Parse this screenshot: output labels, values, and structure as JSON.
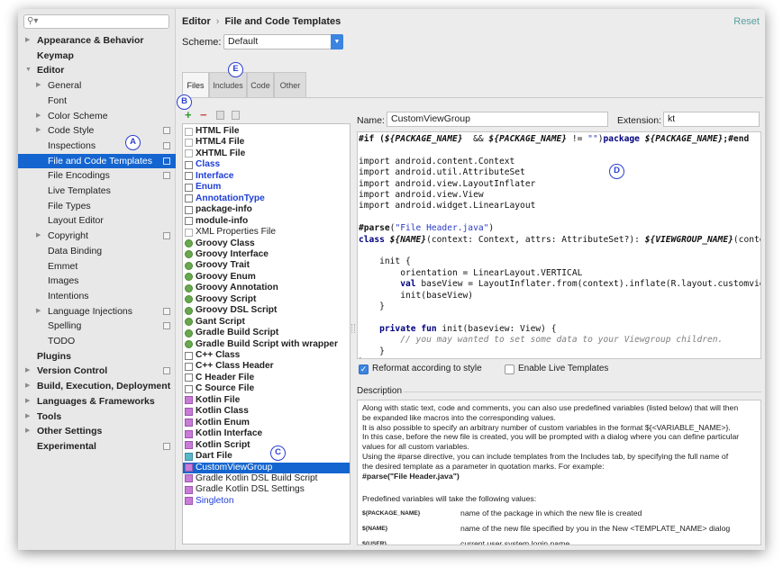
{
  "sidebar": {
    "search_placeholder": "",
    "items": [
      {
        "label": "Appearance & Behavior",
        "level": 0,
        "arrow": true,
        "bold": true
      },
      {
        "label": "Keymap",
        "level": 0,
        "arrow": false,
        "bold": true
      },
      {
        "label": "Editor",
        "level": 0,
        "arrow": true,
        "expanded": true,
        "bold": true
      },
      {
        "label": "General",
        "level": 1,
        "arrow": true
      },
      {
        "label": "Font",
        "level": 1,
        "arrow": false
      },
      {
        "label": "Color Scheme",
        "level": 1,
        "arrow": true
      },
      {
        "label": "Code Style",
        "level": 1,
        "arrow": true,
        "copy": true
      },
      {
        "label": "Inspections",
        "level": 1,
        "arrow": false,
        "copy": true
      },
      {
        "label": "File and Code Templates",
        "level": 1,
        "arrow": false,
        "copy": true,
        "selected": true
      },
      {
        "label": "File Encodings",
        "level": 1,
        "arrow": false,
        "copy": true
      },
      {
        "label": "Live Templates",
        "level": 1,
        "arrow": false
      },
      {
        "label": "File Types",
        "level": 1,
        "arrow": false
      },
      {
        "label": "Layout Editor",
        "level": 1,
        "arrow": false
      },
      {
        "label": "Copyright",
        "level": 1,
        "arrow": true,
        "copy": true
      },
      {
        "label": "Data Binding",
        "level": 1,
        "arrow": false
      },
      {
        "label": "Emmet",
        "level": 1,
        "arrow": false
      },
      {
        "label": "Images",
        "level": 1,
        "arrow": false
      },
      {
        "label": "Intentions",
        "level": 1,
        "arrow": false
      },
      {
        "label": "Language Injections",
        "level": 1,
        "arrow": true,
        "copy": true
      },
      {
        "label": "Spelling",
        "level": 1,
        "arrow": false,
        "copy": true
      },
      {
        "label": "TODO",
        "level": 1,
        "arrow": false
      },
      {
        "label": "Plugins",
        "level": 0,
        "arrow": false,
        "bold": true
      },
      {
        "label": "Version Control",
        "level": 0,
        "arrow": true,
        "bold": true,
        "copy": true
      },
      {
        "label": "Build, Execution, Deployment",
        "level": 0,
        "arrow": true,
        "bold": true
      },
      {
        "label": "Languages & Frameworks",
        "level": 0,
        "arrow": true,
        "bold": true
      },
      {
        "label": "Tools",
        "level": 0,
        "arrow": true,
        "bold": true
      },
      {
        "label": "Other Settings",
        "level": 0,
        "arrow": true,
        "bold": true
      },
      {
        "label": "Experimental",
        "level": 0,
        "arrow": false,
        "bold": true,
        "copy": true
      }
    ]
  },
  "header": {
    "breadcrumb_parent": "Editor",
    "breadcrumb_sep": "›",
    "breadcrumb_current": "File and Code Templates",
    "reset_label": "Reset"
  },
  "scheme": {
    "label": "Scheme:",
    "value": "Default"
  },
  "tabs": [
    {
      "label": "Files",
      "active": true
    },
    {
      "label": "Includes",
      "active": false
    },
    {
      "label": "Code",
      "active": false
    },
    {
      "label": "Other",
      "active": false
    }
  ],
  "toolbar": {
    "add": "+",
    "remove": "−"
  },
  "templates": [
    {
      "name": "HTML File",
      "icon": "html",
      "style": "bold"
    },
    {
      "name": "HTML4 File",
      "icon": "html",
      "style": "bold"
    },
    {
      "name": "XHTML File",
      "icon": "html",
      "style": "bold"
    },
    {
      "name": "Class",
      "icon": "java",
      "style": "blue"
    },
    {
      "name": "Interface",
      "icon": "java",
      "style": "blue"
    },
    {
      "name": "Enum",
      "icon": "java",
      "style": "blue"
    },
    {
      "name": "AnnotationType",
      "icon": "java",
      "style": "blue"
    },
    {
      "name": "package-info",
      "icon": "java",
      "style": "bold"
    },
    {
      "name": "module-info",
      "icon": "java",
      "style": "bold"
    },
    {
      "name": "XML Properties File",
      "icon": "xml",
      "style": "normal"
    },
    {
      "name": "Groovy Class",
      "icon": "groovy",
      "style": "bold"
    },
    {
      "name": "Groovy Interface",
      "icon": "groovy",
      "style": "bold"
    },
    {
      "name": "Groovy Trait",
      "icon": "groovy",
      "style": "bold"
    },
    {
      "name": "Groovy Enum",
      "icon": "groovy",
      "style": "bold"
    },
    {
      "name": "Groovy Annotation",
      "icon": "groovy",
      "style": "bold"
    },
    {
      "name": "Groovy Script",
      "icon": "groovy",
      "style": "bold"
    },
    {
      "name": "Groovy DSL Script",
      "icon": "groovy",
      "style": "bold"
    },
    {
      "name": "Gant Script",
      "icon": "groovy",
      "style": "bold"
    },
    {
      "name": "Gradle Build Script",
      "icon": "groovy",
      "style": "bold"
    },
    {
      "name": "Gradle Build Script with wrapper",
      "icon": "groovy",
      "style": "bold"
    },
    {
      "name": "C++ Class",
      "icon": "cpp",
      "style": "bold"
    },
    {
      "name": "C++ Class Header",
      "icon": "cpp",
      "style": "bold"
    },
    {
      "name": "C Header File",
      "icon": "cpp",
      "style": "bold"
    },
    {
      "name": "C Source File",
      "icon": "cpp",
      "style": "bold"
    },
    {
      "name": "Kotlin File",
      "icon": "kotlin",
      "style": "bold"
    },
    {
      "name": "Kotlin Class",
      "icon": "kotlin",
      "style": "bold"
    },
    {
      "name": "Kotlin Enum",
      "icon": "kotlin",
      "style": "bold"
    },
    {
      "name": "Kotlin Interface",
      "icon": "kotlin",
      "style": "bold"
    },
    {
      "name": "Kotlin Script",
      "icon": "kotlin",
      "style": "bold"
    },
    {
      "name": "Dart File",
      "icon": "dart",
      "style": "bold"
    },
    {
      "name": "CustomViewGroup",
      "icon": "kotlin",
      "style": "normal",
      "selected": true
    },
    {
      "name": "Gradle Kotlin DSL Build Script",
      "icon": "kotlin",
      "style": "normal"
    },
    {
      "name": "Gradle Kotlin DSL Settings",
      "icon": "kotlin",
      "style": "normal"
    },
    {
      "name": "Singleton",
      "icon": "kotlin",
      "style": "normalblue"
    }
  ],
  "name_field": {
    "label": "Name:",
    "value": "CustomViewGroup"
  },
  "extension_field": {
    "label": "Extension:",
    "value": "kt"
  },
  "code_lines": [
    [
      [
        "meta",
        "#if ("
      ],
      [
        "var",
        "${PACKAGE_NAME}"
      ],
      [
        "",
        "  && "
      ],
      [
        "var",
        "${PACKAGE_NAME}"
      ],
      [
        "",
        " != "
      ],
      [
        "str",
        "\"\""
      ],
      [
        "",
        ")"
      ],
      [
        "kw",
        "package "
      ],
      [
        "var",
        "${PACKAGE_NAME}"
      ],
      [
        "meta",
        ";#end"
      ]
    ],
    [],
    [
      [
        "",
        "import android.content.Context"
      ]
    ],
    [
      [
        "",
        "import android.util.AttributeSet"
      ]
    ],
    [
      [
        "",
        "import android.view.LayoutInflater"
      ]
    ],
    [
      [
        "",
        "import android.view.View"
      ]
    ],
    [
      [
        "",
        "import android.widget.LinearLayout"
      ]
    ],
    [],
    [
      [
        "meta",
        "#parse"
      ],
      [
        "",
        "("
      ],
      [
        "str",
        "\"File Header.java\""
      ],
      [
        "",
        ")"
      ]
    ],
    [
      [
        "kw",
        "class "
      ],
      [
        "var",
        "${NAME}"
      ],
      [
        "",
        "(context: Context, attrs: AttributeSet?): "
      ],
      [
        "var",
        "${VIEWGROUP_NAME}"
      ],
      [
        "",
        "(context,"
      ]
    ],
    [],
    [
      [
        "",
        "    init {"
      ]
    ],
    [
      [
        "",
        "        orientation = LinearLayout.VERTICAL"
      ]
    ],
    [
      [
        "",
        "        "
      ],
      [
        "kw",
        "val "
      ],
      [
        "",
        "baseView = LayoutInflater.from(context).inflate(R.layout.customview,"
      ]
    ],
    [
      [
        "",
        "        init(baseView)"
      ]
    ],
    [
      [
        "",
        "    }"
      ]
    ],
    [],
    [
      [
        "",
        "    "
      ],
      [
        "kw",
        "private fun "
      ],
      [
        "",
        "init(baseview: View) {"
      ]
    ],
    [
      [
        "",
        "        "
      ],
      [
        "cm",
        "// you may wanted to set some data to your Viewgroup children."
      ]
    ],
    [
      [
        "",
        "    }"
      ]
    ],
    [
      [
        "",
        "}"
      ]
    ]
  ],
  "options": {
    "reformat_label": "Reformat according to style",
    "reformat_checked": true,
    "live_label": "Enable Live Templates",
    "live_checked": false
  },
  "description": {
    "label": "Description",
    "lines": [
      "Along with static text, code and comments, you can also use predefined variables (listed below) that will then",
      "be expanded like macros into the corresponding values.",
      "It is also possible to specify an arbitrary number of custom variables in the format ${<VARIABLE_NAME>}.",
      "In this case, before the new file is created, you will be prompted with a dialog where you can define particular",
      "values for all custom variables.",
      "Using the #parse directive, you can include templates from the Includes tab, by specifying the full name of",
      "the desired template as a parameter in quotation marks. For example:"
    ],
    "example": "#parse(\"File Header.java\")",
    "vars_intro": "Predefined variables will take the following values:",
    "vars": [
      {
        "name": "${PACKAGE_NAME}",
        "desc": "name of the package in which the new file is created"
      },
      {
        "name": "${NAME}",
        "desc": "name of the new file specified by you in the New <TEMPLATE_NAME> dialog"
      },
      {
        "name": "${USER}",
        "desc": "current user system login name"
      }
    ]
  },
  "callouts": {
    "a": "A",
    "b": "B",
    "c": "C",
    "d": "D",
    "e": "E"
  },
  "colors": {
    "selection": "#1565d0",
    "accent": "#3b84e0",
    "callout": "#2b3fd0",
    "reset": "#58a0a0"
  }
}
